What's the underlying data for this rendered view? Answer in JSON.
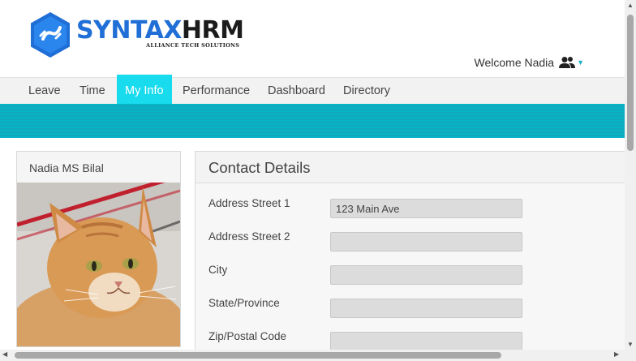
{
  "brand": {
    "name_part1": "SYNTAX",
    "name_part2": "HRM",
    "tagline": "ALLIANCE TECH SOLUTIONS",
    "primary_color": "#1f6fd6",
    "accent_color": "#18dbee"
  },
  "header": {
    "welcome_text": "Welcome Nadia",
    "user_icon": "users-icon",
    "dropdown_icon": "caret-down-icon"
  },
  "nav": {
    "items": [
      {
        "label": "Leave",
        "active": false
      },
      {
        "label": "Time",
        "active": false
      },
      {
        "label": "My Info",
        "active": true
      },
      {
        "label": "Performance",
        "active": false
      },
      {
        "label": "Dashboard",
        "active": false
      },
      {
        "label": "Directory",
        "active": false
      }
    ]
  },
  "profile": {
    "name": "Nadia MS Bilal",
    "photo": "cat-photo"
  },
  "contact": {
    "title": "Contact Details",
    "fields": [
      {
        "label": "Address Street 1",
        "value": "123 Main Ave"
      },
      {
        "label": "Address Street 2",
        "value": ""
      },
      {
        "label": "City",
        "value": ""
      },
      {
        "label": "State/Province",
        "value": ""
      },
      {
        "label": "Zip/Postal Code",
        "value": ""
      }
    ]
  }
}
